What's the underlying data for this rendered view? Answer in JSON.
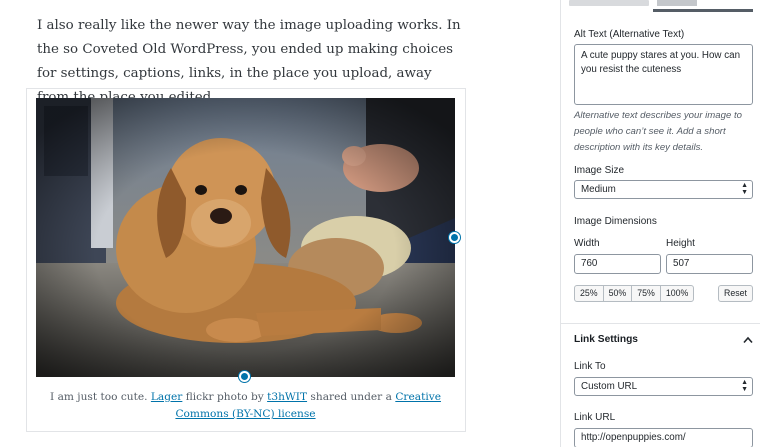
{
  "editor": {
    "paragraph": "I also really like the newer way the image uploading works. In the so Coveted Old WordPress, you ended up making choices for settings, captions, links, in the place you upload, away from the place you edited.",
    "caption": {
      "prefix": "I am just too cute. ",
      "link_lager": "Lager",
      "mid1": " flickr photo by ",
      "link_author": "t3hWIT",
      "mid2": " shared under a ",
      "link_license": "Creative Commons (BY-NC) license"
    }
  },
  "sidebar": {
    "alt_text_label": "Alt Text (Alternative Text)",
    "alt_text_value": "A cute puppy stares at you. How can you resist the cuteness",
    "alt_help": "Alternative text describes your image to people who can’t see it. Add a short description with its key details.",
    "image_size_label": "Image Size",
    "image_size_value": "Medium",
    "dimensions_label": "Image Dimensions",
    "width_label": "Width",
    "height_label": "Height",
    "width_value": "760",
    "height_value": "507",
    "percent_buttons": [
      "25%",
      "50%",
      "75%",
      "100%"
    ],
    "reset_label": "Reset",
    "link_settings_title": "Link Settings",
    "link_to_label": "Link To",
    "link_to_value": "Custom URL",
    "link_url_label": "Link URL",
    "link_url_value": "http://openpuppies.com/"
  },
  "colors": {
    "accent": "#0073aa",
    "border": "#8d96a0",
    "text": "#23282d"
  },
  "icons": {
    "chevron": "chevron-up-icon",
    "select_arrows": "select-arrows-icon",
    "resize_handle": "resize-handle-icon"
  }
}
